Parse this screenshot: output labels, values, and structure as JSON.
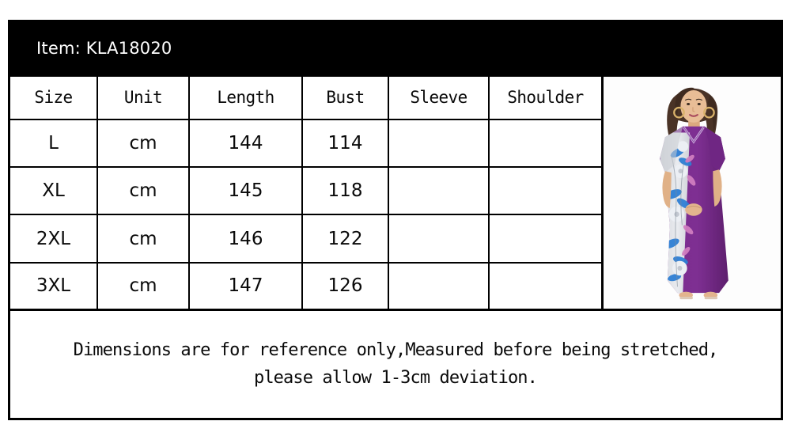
{
  "header": {
    "item_label": "Item: KLA18020"
  },
  "table": {
    "columns": [
      "Size",
      "Unit",
      "Length",
      "Bust",
      "Sleeve",
      "Shoulder"
    ],
    "rows": [
      [
        "L",
        "cm",
        "144",
        "114",
        "",
        ""
      ],
      [
        "XL",
        "cm",
        "145",
        "118",
        "",
        ""
      ],
      [
        "2XL",
        "cm",
        "146",
        "122",
        "",
        ""
      ],
      [
        "3XL",
        "cm",
        "147",
        "126",
        "",
        ""
      ]
    ]
  },
  "photo": {
    "alt": "model-wearing-purple-floral-maxi-dress",
    "colors": {
      "dress_purple": "#7b2d8e",
      "dress_purple_dark": "#5e1f6e",
      "floral_blue": "#2f7fd4",
      "floral_pink": "#d07ec0",
      "floral_white": "#eceff4",
      "skin": "#e3b48e",
      "hair": "#4a3326",
      "background": "#fdfdfd"
    }
  },
  "note": {
    "line1": "Dimensions are for reference only,Measured before being stretched,",
    "line2": "please allow 1-3cm deviation."
  },
  "theme": {
    "frame": "#000000",
    "band_bg": "#000000",
    "band_text": "#ffffff",
    "page_bg": "#ffffff",
    "grid": "#000000"
  }
}
